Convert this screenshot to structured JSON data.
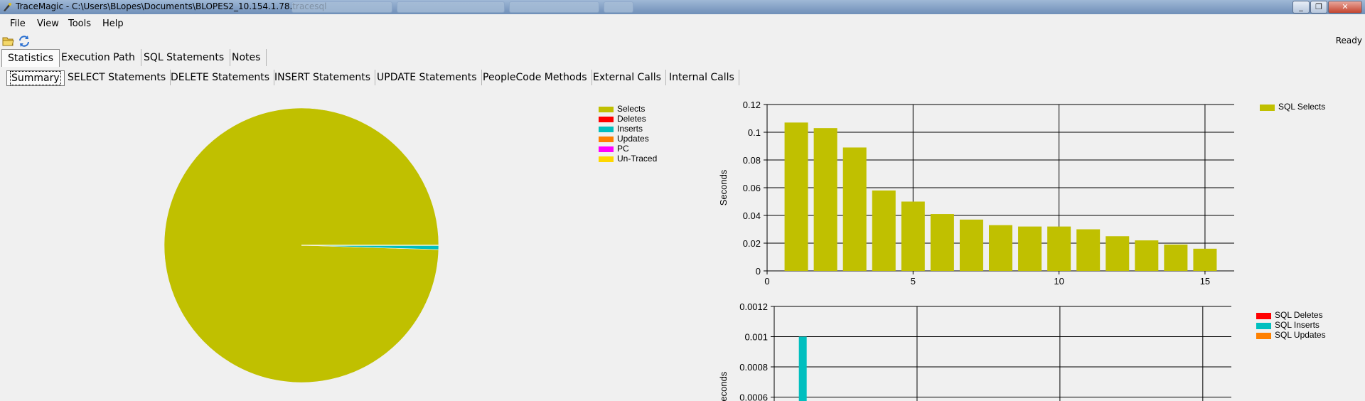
{
  "window": {
    "title": "TraceMagic - C:\\Users\\BLopes\\Documents\\BLOPES2_10.154.1.78.tracesql",
    "minimize": "_",
    "restore": "❐",
    "close": "✕"
  },
  "menu": [
    "File",
    "View",
    "Tools",
    "Help"
  ],
  "status": "Ready",
  "main_tabs": [
    {
      "label": "Statistics",
      "active": true
    },
    {
      "label": "Execution Path",
      "active": false
    },
    {
      "label": "SQL Statements",
      "active": false
    },
    {
      "label": "Notes",
      "active": false
    }
  ],
  "sub_tabs": [
    {
      "label": "Summary",
      "active": true
    },
    {
      "label": "SELECT Statements",
      "active": false
    },
    {
      "label": "DELETE Statements",
      "active": false
    },
    {
      "label": "INSERT Statements",
      "active": false
    },
    {
      "label": "UPDATE Statements",
      "active": false
    },
    {
      "label": "PeopleCode Methods",
      "active": false
    },
    {
      "label": "External Calls",
      "active": false
    },
    {
      "label": "Internal Calls",
      "active": false
    }
  ],
  "colors": {
    "selects": "#c0c000",
    "deletes": "#ff0000",
    "inserts": "#00bfbf",
    "updates": "#ff8000",
    "pc": "#ff00ff",
    "untraced": "#ffd700"
  },
  "chart_data": [
    {
      "type": "pie",
      "legend": [
        {
          "name": "Selects",
          "color": "#c0c000",
          "value": 0.995
        },
        {
          "name": "Deletes",
          "color": "#ff0000",
          "value": 0
        },
        {
          "name": "Inserts",
          "color": "#00bfbf",
          "value": 0.005
        },
        {
          "name": "Updates",
          "color": "#ff8000",
          "value": 0
        },
        {
          "name": "PC",
          "color": "#ff00ff",
          "value": 0
        },
        {
          "name": "Un-Traced",
          "color": "#ffd700",
          "value": 0
        }
      ]
    },
    {
      "type": "bar",
      "ylabel": "Seconds",
      "xlim": [
        0,
        16
      ],
      "ylim": [
        0,
        0.12
      ],
      "xticks": [
        "0",
        "5",
        "10",
        "15"
      ],
      "yticks": [
        "0",
        "0.02",
        "0.04",
        "0.06",
        "0.08",
        "0.1",
        "0.12"
      ],
      "series": [
        {
          "name": "SQL Selects",
          "color": "#c0c000",
          "x": [
            1,
            2,
            3,
            4,
            5,
            6,
            7,
            8,
            9,
            10,
            11,
            12,
            13,
            14,
            15
          ],
          "values": [
            0.107,
            0.103,
            0.089,
            0.058,
            0.05,
            0.041,
            0.037,
            0.033,
            0.032,
            0.032,
            0.03,
            0.025,
            0.022,
            0.019,
            0.016
          ]
        }
      ],
      "legend_position": "top-right",
      "grid": true
    },
    {
      "type": "bar",
      "ylabel": "Seconds",
      "xlim": [
        0,
        16
      ],
      "ylim": [
        0,
        0.0012
      ],
      "yticks": [
        "0.0006",
        "0.0008",
        "0.001",
        "0.0012"
      ],
      "series": [
        {
          "name": "SQL Deletes",
          "color": "#ff0000",
          "x": [],
          "values": []
        },
        {
          "name": "SQL Inserts",
          "color": "#00bfbf",
          "x": [
            1
          ],
          "values": [
            0.001
          ]
        },
        {
          "name": "SQL Updates",
          "color": "#ff8000",
          "x": [],
          "values": []
        }
      ],
      "legend_position": "top-right",
      "grid": true
    }
  ]
}
